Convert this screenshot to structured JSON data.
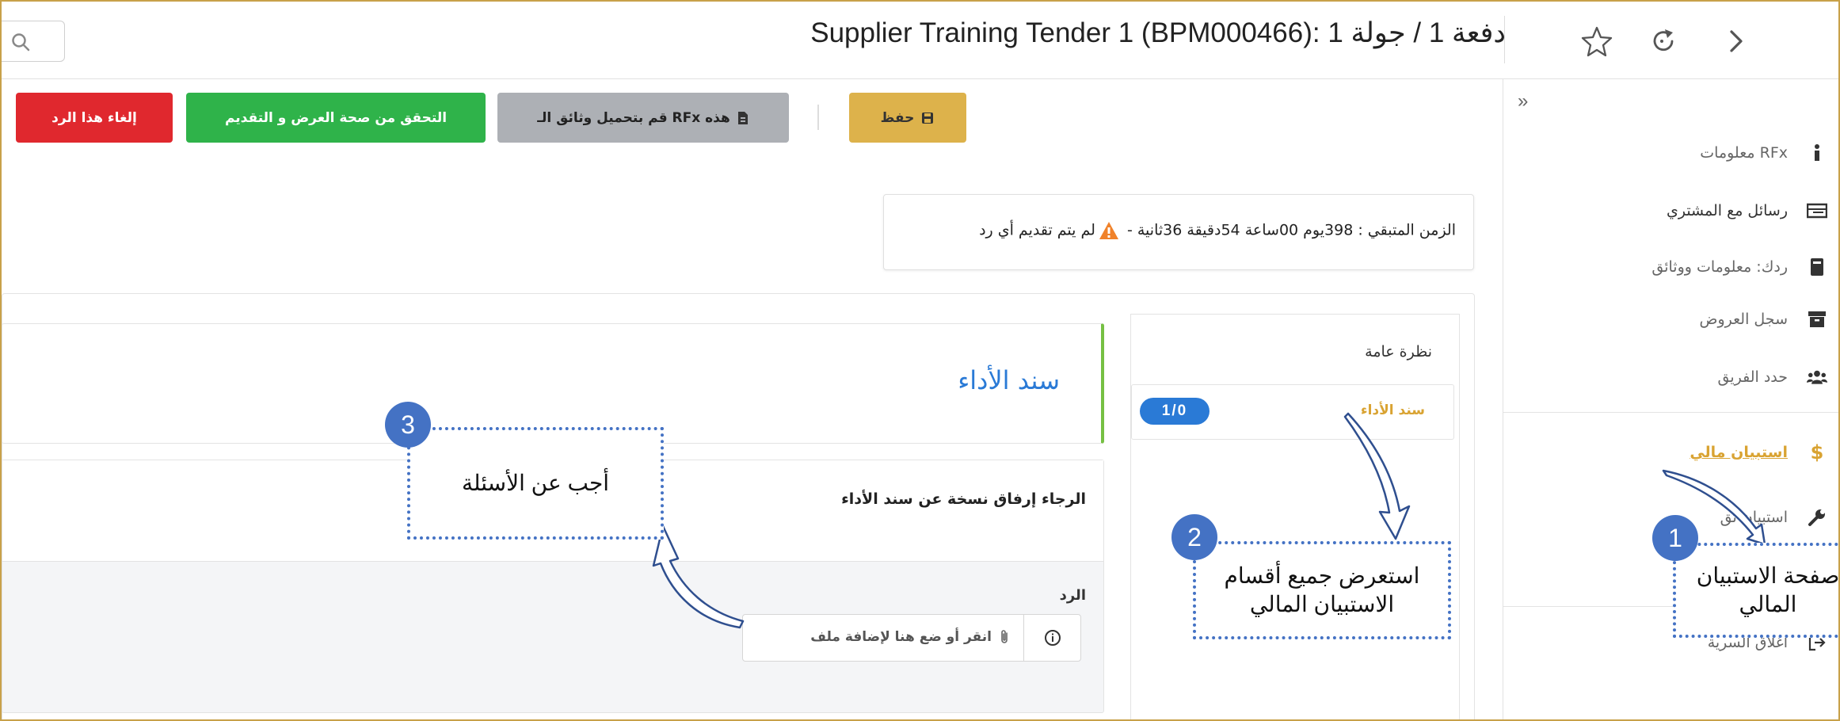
{
  "header": {
    "title": "Supplier Training Tender 1 (BPM000466): دفعة 1 / جولة 1"
  },
  "sidebar": {
    "items": [
      {
        "label": "معلومات RFx",
        "icon": "info-icon"
      },
      {
        "label": "رسائل مع المشتري",
        "icon": "envelope-icon"
      },
      {
        "label": "ردك: معلومات ووثائق",
        "icon": "book-icon"
      },
      {
        "label": "سجل العروض",
        "icon": "archive-icon"
      },
      {
        "label": "حدد الفريق",
        "icon": "users-icon"
      },
      {
        "label": "استبيان مالي",
        "icon": "dollar-icon"
      },
      {
        "label": "استبيان تق",
        "icon": "wrench-icon"
      },
      {
        "label": "اغلاق السرية",
        "icon": "sign-out-icon"
      }
    ]
  },
  "toolbar": {
    "save_label": "حفظ",
    "upload_label": "قم بتحميل وثائق الـ RFx هذه",
    "validate_label": "التحقق من صحة العرض و التقديم",
    "cancel_label": "إلغاء هذا الرد"
  },
  "timer": {
    "text_prefix": "الزمن المتبقي :  398يوم 00ساعة 54دقيقة 36ثانية - ",
    "text_suffix": "لم يتم تقديم أي رد"
  },
  "nav": {
    "overview_label": "نظرة عامة",
    "section_label": "سند الأداء",
    "section_badge": "1/0"
  },
  "section": {
    "title": "سند الأداء",
    "question": "الرجاء إرفاق نسخة عن سند الأداء",
    "response_label": "الرد",
    "upload_placeholder": "انقر أو ضع هنا لإضافة ملف"
  },
  "callouts": [
    {
      "number": "1",
      "text_line1": "صفحة الاستبيان",
      "text_line2": "المالي"
    },
    {
      "number": "2",
      "text_line1": "استعرض جميع أقسام",
      "text_line2": "الاستبيان المالي"
    },
    {
      "number": "3",
      "text_line1": "أجب عن الأسئلة",
      "text_line2": ""
    }
  ],
  "colors": {
    "accent_blue": "#2a7ad6",
    "gold": "#d9a332",
    "green": "#2fb34a",
    "red": "#e0282e",
    "callout_blue": "#4472c4"
  }
}
